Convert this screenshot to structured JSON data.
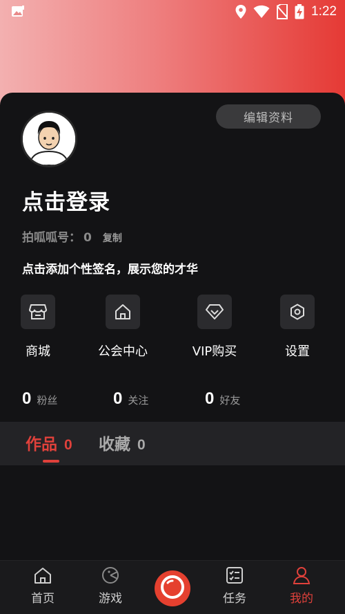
{
  "status": {
    "time": "1:22",
    "icons": [
      "gallery-notification-icon",
      "location-icon",
      "wifi-icon",
      "no-sim-icon",
      "battery-charging-icon"
    ]
  },
  "profile": {
    "edit_label": "编辑资料",
    "login_title": "点击登录",
    "id_label": "拍呱呱号：",
    "id_value": "0",
    "copy_label": "复制",
    "signature": "点击添加个性签名，展示您的才华"
  },
  "features": [
    {
      "label": "商城",
      "icon": "store-icon"
    },
    {
      "label": "公会中心",
      "icon": "home-icon"
    },
    {
      "label": "VIP购买",
      "icon": "diamond-icon"
    },
    {
      "label": "设置",
      "icon": "gear-icon"
    }
  ],
  "stats": [
    {
      "value": "0",
      "label": "粉丝"
    },
    {
      "value": "0",
      "label": "关注"
    },
    {
      "value": "0",
      "label": "好友"
    }
  ],
  "tabs": [
    {
      "label": "作品",
      "count": "0",
      "active": true
    },
    {
      "label": "收藏",
      "count": "0",
      "active": false
    }
  ],
  "nav": [
    {
      "label": "首页",
      "icon": "home-icon"
    },
    {
      "label": "游戏",
      "icon": "game-icon"
    },
    {
      "label": "",
      "icon": "record-icon"
    },
    {
      "label": "任务",
      "icon": "task-list-icon"
    },
    {
      "label": "我的",
      "icon": "user-icon",
      "active": true
    }
  ],
  "colors": {
    "accent": "#e0413b",
    "background": "#131315",
    "tab_bar": "#232326",
    "gradient_start": "#f3b0b0",
    "gradient_end": "#e53a35"
  }
}
